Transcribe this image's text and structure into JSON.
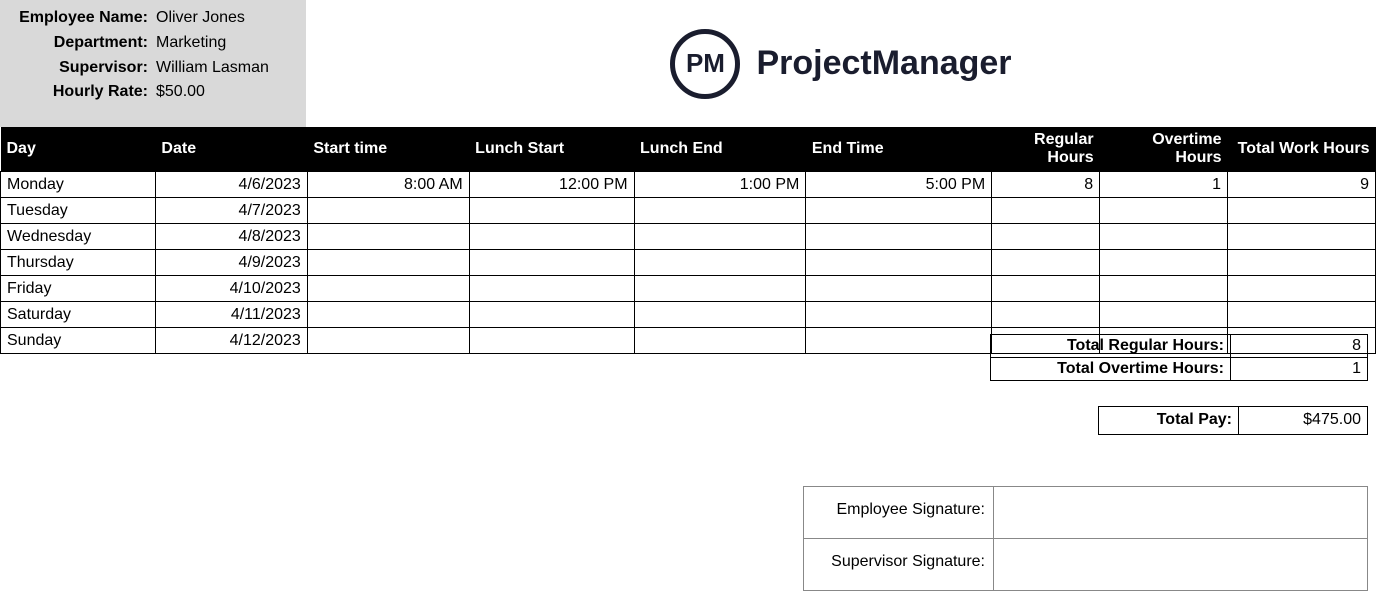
{
  "employee": {
    "name_label": "Employee Name:",
    "name": "Oliver Jones",
    "dept_label": "Department:",
    "dept": "Marketing",
    "supervisor_label": "Supervisor:",
    "supervisor": "William Lasman",
    "rate_label": "Hourly Rate:",
    "rate": "$50.00"
  },
  "brand": {
    "icon": "PM",
    "name": "ProjectManager"
  },
  "headers": {
    "day": "Day",
    "date": "Date",
    "start": "Start time",
    "lunch_start": "Lunch Start",
    "lunch_end": "Lunch End",
    "end": "End Time",
    "regular": "Regular Hours",
    "overtime": "Overtime Hours",
    "total": "Total Work Hours"
  },
  "rows": [
    {
      "day": "Monday",
      "date": "4/6/2023",
      "start": "8:00 AM",
      "lunch_start": "12:00 PM",
      "lunch_end": "1:00 PM",
      "end": "5:00 PM",
      "regular": "8",
      "overtime": "1",
      "total": "9"
    },
    {
      "day": "Tuesday",
      "date": "4/7/2023",
      "start": "",
      "lunch_start": "",
      "lunch_end": "",
      "end": "",
      "regular": "",
      "overtime": "",
      "total": ""
    },
    {
      "day": "Wednesday",
      "date": "4/8/2023",
      "start": "",
      "lunch_start": "",
      "lunch_end": "",
      "end": "",
      "regular": "",
      "overtime": "",
      "total": ""
    },
    {
      "day": "Thursday",
      "date": "4/9/2023",
      "start": "",
      "lunch_start": "",
      "lunch_end": "",
      "end": "",
      "regular": "",
      "overtime": "",
      "total": ""
    },
    {
      "day": "Friday",
      "date": "4/10/2023",
      "start": "",
      "lunch_start": "",
      "lunch_end": "",
      "end": "",
      "regular": "",
      "overtime": "",
      "total": ""
    },
    {
      "day": "Saturday",
      "date": "4/11/2023",
      "start": "",
      "lunch_start": "",
      "lunch_end": "",
      "end": "",
      "regular": "",
      "overtime": "",
      "total": ""
    },
    {
      "day": "Sunday",
      "date": "4/12/2023",
      "start": "",
      "lunch_start": "",
      "lunch_end": "",
      "end": "",
      "regular": "",
      "overtime": "",
      "total": ""
    }
  ],
  "totals": {
    "regular_label": "Total Regular Hours:",
    "regular": "8",
    "overtime_label": "Total Overtime Hours:",
    "overtime": "1",
    "pay_label": "Total Pay:",
    "pay": "$475.00"
  },
  "signatures": {
    "employee_label": "Employee Signature:",
    "supervisor_label": "Supervisor Signature:"
  }
}
